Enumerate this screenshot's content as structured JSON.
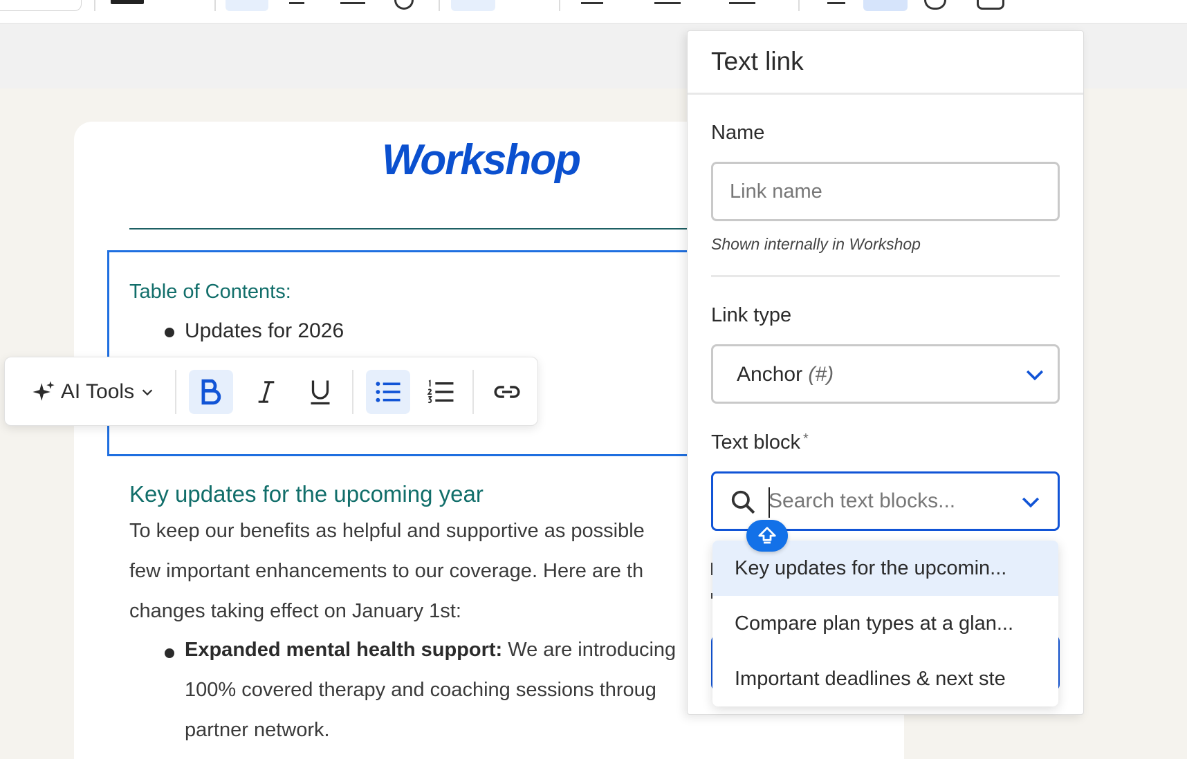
{
  "panel": {
    "title": "Text link",
    "name_label": "Name",
    "name_placeholder": "Link name",
    "name_hint": "Shown internally in Workshop",
    "link_type_label": "Link type",
    "link_type_value": "Anchor",
    "link_type_suffix": "(#)",
    "text_block_label": "Text block",
    "text_block_required": "*",
    "search_placeholder": "Search text blocks...",
    "dropdown_options": [
      "Key updates for the upcomin...",
      "Compare plan types at a glan...",
      "Important deadlines & next ste"
    ]
  },
  "toolbar": {
    "ai_tools_label": "AI Tools"
  },
  "document": {
    "logo": "Workshop",
    "toc_title": "Table of Contents:",
    "toc_items": [
      "Updates for 2026"
    ],
    "section_heading": "Key updates for the upcoming year",
    "paragraph_lines": [
      "To keep our benefits as helpful and supportive as possible",
      "few important enhancements to our coverage. Here are th",
      "changes taking effect on January 1st:"
    ],
    "bullet_bold": "Expanded mental health support:",
    "bullet_text": " We are introducing",
    "bullet_cont_lines": [
      "100% covered therapy and coaching sessions throug",
      "partner network."
    ]
  },
  "colors": {
    "brand_blue": "#0b50cf",
    "heading_teal": "#116e6a",
    "focus_blue": "#1154d6",
    "hover_bg": "#e6effc"
  }
}
